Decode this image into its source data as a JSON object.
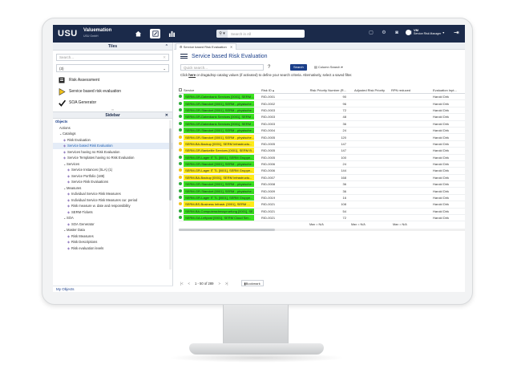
{
  "header": {
    "logo": "USU",
    "brand": "Valuemation",
    "brand_sub": "USU GmbH",
    "search_picker": "⚲ ▾",
    "search_placeholder": "Search in All",
    "user_initials": "VM",
    "user_role": "Service Risk Manager",
    "user_caret": "▾"
  },
  "tiles": {
    "title": "Tiles",
    "search_placeholder": "Search...",
    "filter_value": "(3)",
    "items": [
      {
        "label": "Risk Assessment",
        "icon": "risk-assessment-icon"
      },
      {
        "label": "Service based risk evaluation",
        "icon": "triangle-flag-icon"
      },
      {
        "label": "SOA Generator",
        "icon": "checkmark-icon"
      }
    ]
  },
  "sidebar": {
    "title": "Sidebar",
    "tree": [
      {
        "label": "Objects",
        "level": 0,
        "type": "section"
      },
      {
        "label": "Actions",
        "level": 1,
        "type": "plain"
      },
      {
        "label": "Catalogs",
        "level": 1,
        "type": "caret"
      },
      {
        "label": "Risk Evaluation",
        "level": 2,
        "type": "item"
      },
      {
        "label": "Service based Risk Evaluation",
        "level": 2,
        "type": "item",
        "selected": true
      },
      {
        "label": "Services having no Risk Evaluation",
        "level": 2,
        "type": "item"
      },
      {
        "label": "Service Templates having no Risk Evaluation",
        "level": 2,
        "type": "item"
      },
      {
        "label": "Services",
        "level": 2,
        "type": "caret"
      },
      {
        "label": "Service Instances (SLA) (1)",
        "level": 3,
        "type": "item"
      },
      {
        "label": "Service Portfolio (188)",
        "level": 3,
        "type": "item"
      },
      {
        "label": "Service Risk Evaluations",
        "level": 3,
        "type": "item"
      },
      {
        "label": "Measures",
        "level": 2,
        "type": "caret"
      },
      {
        "label": "Individual Service Risk Measures",
        "level": 3,
        "type": "item"
      },
      {
        "label": "Individual Service Risk Measures cur. period",
        "level": 3,
        "type": "item"
      },
      {
        "label": "Risk measure w. date and responsibility",
        "level": 3,
        "type": "item"
      },
      {
        "label": "SERM-Tickets",
        "level": 3,
        "type": "item"
      },
      {
        "label": "SOA",
        "level": 2,
        "type": "caret"
      },
      {
        "label": "SOA Generator",
        "level": 3,
        "type": "item"
      },
      {
        "label": "Master Data",
        "level": 2,
        "type": "caret"
      },
      {
        "label": "Risk Measures",
        "level": 3,
        "type": "item"
      },
      {
        "label": "Risk Descriptions",
        "level": 3,
        "type": "item"
      },
      {
        "label": "Risk evaluation levels",
        "level": 3,
        "type": "item"
      }
    ],
    "my_objects": "My Objects"
  },
  "main": {
    "tab_label": "Service based Risk Evaluation",
    "page_title": "Service based Risk Evaluation",
    "quick_search_placeholder": "Quick search...",
    "help": "?",
    "search_button": "Search",
    "column_search": "Column Search ▾",
    "hint_pre": "Click ",
    "hint_link": "here",
    "hint_post": " or drag&drop catalog values (if activated) to define your search criteria. Alternatively, select a saved filter.",
    "columns": [
      "Service",
      "Risk ID ▴",
      "Risk Priority Number (R...",
      "Adjusted Risk Priority",
      "RPN reduced",
      "Evaluation Inpt..."
    ],
    "rows": [
      {
        "status": "green",
        "service": "SERM-GR-Datenbank Services [0001], SERM ...",
        "risk_id": "RID-0001",
        "rpn": "90",
        "eval": "Harold Dirk"
      },
      {
        "status": "green",
        "service": "SERM-GR-Standort [0001], SERM - physische...",
        "risk_id": "RID-0002",
        "rpn": "96",
        "eval": "Harold Dirk"
      },
      {
        "status": "green",
        "service": "SERM-GR-Standort [0001], SERM - physische...",
        "risk_id": "RID-0003",
        "rpn": "72",
        "eval": "Harold Dirk"
      },
      {
        "status": "green",
        "service": "SERM-GR-Datenbank Services [0001], SERM ...",
        "risk_id": "RID-0003",
        "rpn": "48",
        "eval": "Harold Dirk"
      },
      {
        "status": "green",
        "service": "SERM-GR-Datenbank Services [0001], SERM ...",
        "risk_id": "RID-0003",
        "rpn": "36",
        "eval": "Harold Dirk"
      },
      {
        "status": "green",
        "service": "SERM-GR-Standort [0001], SERM - physische...",
        "risk_id": "RID-0004",
        "rpn": "24",
        "eval": "Harold Dirk"
      },
      {
        "status": "yellow",
        "service": "SERM-GR-Standort [0001], SERM - physische...",
        "risk_id": "RID-0005",
        "rpn": "120",
        "eval": "Harold Dirk"
      },
      {
        "status": "yellow",
        "service": "SERM-BA-Backup [0001], SERM Infrastructu...",
        "risk_id": "RID-0005",
        "rpn": "147",
        "eval": "Harold Dirk"
      },
      {
        "status": "yellow",
        "service": "SERM-GR-Bankelite Services [0001], SERM B...",
        "risk_id": "RID-0005",
        "rpn": "147",
        "eval": "Harold Dirk"
      },
      {
        "status": "green",
        "service": "SERM-GR-Lager IT TL [0001], SERM Gruppe...",
        "risk_id": "RID-0005",
        "rpn": "100",
        "eval": "Harold Dirk"
      },
      {
        "status": "green",
        "service": "SERM-GR-Standort [0001], SERM - physische...",
        "risk_id": "RID-0006",
        "rpn": "24",
        "eval": "Harold Dirk"
      },
      {
        "status": "yellow",
        "service": "SERM-GR-Lager IT TL [0001], SERM Gruppe...",
        "risk_id": "RID-0006",
        "rpn": "144",
        "eval": "Harold Dirk"
      },
      {
        "status": "yellow",
        "service": "SERM-BA-Backup [0001], SERM Infrastructu...",
        "risk_id": "RID-0007",
        "rpn": "168",
        "eval": "Harold Dirk"
      },
      {
        "status": "green",
        "service": "SERM-GR-Standort [0001], SERM - physische...",
        "risk_id": "RID-0008",
        "rpn": "36",
        "eval": "Harold Dirk"
      },
      {
        "status": "green",
        "service": "SERM-GR-Standort [0001], SERM - physische...",
        "risk_id": "RID-0009",
        "rpn": "36",
        "eval": "Harold Dirk"
      },
      {
        "status": "green",
        "service": "SERM-GR-Lager IT TL [0001], SERM Gruppe...",
        "risk_id": "RID-0019",
        "rpn": "16",
        "eval": "Harold Dirk"
      },
      {
        "status": "yellow",
        "service": "SERM-BS-Business Infrastr. [0001], SERM ...",
        "risk_id": "RID-0021",
        "rpn": "108",
        "eval": "Harold Dirk"
      },
      {
        "status": "green",
        "service": "SERM-BA-Computeradresspruefung [0001], SE...",
        "risk_id": "RID-0021",
        "rpn": "54",
        "eval": "Harold Dirk"
      },
      {
        "status": "green",
        "service": "SERM-GA-Leitpost [0001], SERM Cloud Ser...",
        "risk_id": "RID-0021",
        "rpn": "72",
        "eval": "Harold Dirk"
      }
    ],
    "summary": [
      "Max = N/A",
      "Max = N/A",
      "Max = N/A"
    ],
    "pager": {
      "first": "|<",
      "prev": "<",
      "range": "1 - 50 of 289",
      "next": ">",
      "last": ">|",
      "bookmark": "Bookmark"
    }
  },
  "colors": {
    "header_bg": "#1b2a4a",
    "accent": "#1b3f8a",
    "status_green": "#2eaa3a",
    "status_yellow": "#f2c21a",
    "cell_green": "#39e21f",
    "cell_yellow": "#ffeb18"
  }
}
